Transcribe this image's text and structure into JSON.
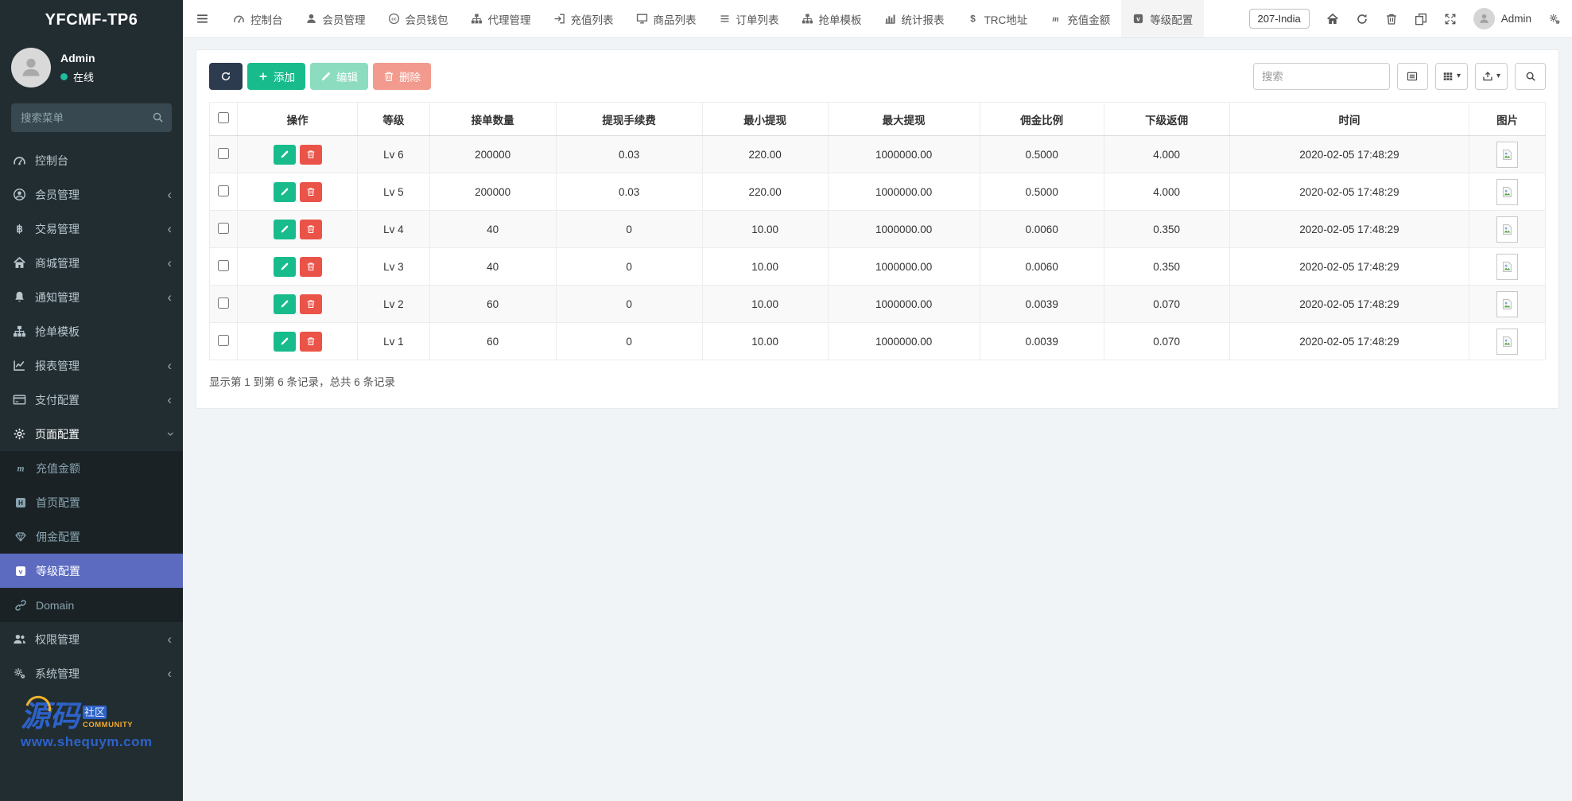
{
  "brand": "YFCMF-TP6",
  "user": {
    "name": "Admin",
    "status": "在线"
  },
  "sidebar": {
    "search_placeholder": "搜索菜单",
    "items": [
      {
        "label": "控制台",
        "icon": "gauge-icon"
      },
      {
        "label": "会员管理",
        "icon": "user-circle-icon",
        "expandable": true
      },
      {
        "label": "交易管理",
        "icon": "bitcoin-icon",
        "expandable": true
      },
      {
        "label": "商城管理",
        "icon": "home-icon",
        "expandable": true
      },
      {
        "label": "通知管理",
        "icon": "bell-icon",
        "expandable": true
      },
      {
        "label": "抢单模板",
        "icon": "sitemap-icon"
      },
      {
        "label": "报表管理",
        "icon": "chart-line-icon",
        "expandable": true
      },
      {
        "label": "支付配置",
        "icon": "credit-card-icon",
        "expandable": true
      },
      {
        "label": "页面配置",
        "icon": "gear-icon",
        "expandable": true,
        "expanded": true,
        "children": [
          {
            "label": "充值金额",
            "icon": "m-icon"
          },
          {
            "label": "首页配置",
            "icon": "h-icon"
          },
          {
            "label": "佣金配置",
            "icon": "gem-icon"
          },
          {
            "label": "等级配置",
            "icon": "v-badge-icon",
            "active": true
          },
          {
            "label": "Domain",
            "icon": "link-icon"
          }
        ]
      },
      {
        "label": "权限管理",
        "icon": "users-icon",
        "expandable": true
      },
      {
        "label": "系统管理",
        "icon": "cogs-icon",
        "expandable": true
      }
    ],
    "watermark": {
      "primary": "源码",
      "secondary": "社区",
      "tertiary": "COMMUNITY",
      "url": "www.shequym.com"
    }
  },
  "topnav": {
    "tabs": [
      {
        "label": "控制台",
        "icon": "gauge-icon"
      },
      {
        "label": "会员管理",
        "icon": "user-icon"
      },
      {
        "label": "会员钱包",
        "icon": "wallet-icon"
      },
      {
        "label": "代理管理",
        "icon": "sitemap-icon"
      },
      {
        "label": "充值列表",
        "icon": "sign-in-icon"
      },
      {
        "label": "商品列表",
        "icon": "desktop-icon"
      },
      {
        "label": "订单列表",
        "icon": "list-icon"
      },
      {
        "label": "抢单模板",
        "icon": "sitemap-icon"
      },
      {
        "label": "统计报表",
        "icon": "bar-chart-icon"
      },
      {
        "label": "TRC地址",
        "icon": "dollar-icon"
      },
      {
        "label": "充值金额",
        "icon": "m-icon"
      },
      {
        "label": "等级配置",
        "icon": "v-badge-icon",
        "active": true
      }
    ],
    "region_badge": "207-India",
    "admin_label": "Admin"
  },
  "toolbar": {
    "add_label": "添加",
    "edit_label": "编辑",
    "delete_label": "删除",
    "search_placeholder": "搜索"
  },
  "table": {
    "columns": [
      "操作",
      "等级",
      "接单数量",
      "提现手续费",
      "最小提现",
      "最大提现",
      "佣金比例",
      "下级返佣",
      "时间",
      "图片"
    ],
    "rows": [
      {
        "level": "Lv 6",
        "qty": "200000",
        "fee": "0.03",
        "min_withdraw": "220.00",
        "max_withdraw": "1000000.00",
        "ratio": "0.5000",
        "rebate": "4.000",
        "time": "2020-02-05 17:48:29"
      },
      {
        "level": "Lv 5",
        "qty": "200000",
        "fee": "0.03",
        "min_withdraw": "220.00",
        "max_withdraw": "1000000.00",
        "ratio": "0.5000",
        "rebate": "4.000",
        "time": "2020-02-05 17:48:29"
      },
      {
        "level": "Lv 4",
        "qty": "40",
        "fee": "0",
        "min_withdraw": "10.00",
        "max_withdraw": "1000000.00",
        "ratio": "0.0060",
        "rebate": "0.350",
        "time": "2020-02-05 17:48:29"
      },
      {
        "level": "Lv 3",
        "qty": "40",
        "fee": "0",
        "min_withdraw": "10.00",
        "max_withdraw": "1000000.00",
        "ratio": "0.0060",
        "rebate": "0.350",
        "time": "2020-02-05 17:48:29"
      },
      {
        "level": "Lv 2",
        "qty": "60",
        "fee": "0",
        "min_withdraw": "10.00",
        "max_withdraw": "1000000.00",
        "ratio": "0.0039",
        "rebate": "0.070",
        "time": "2020-02-05 17:48:29"
      },
      {
        "level": "Lv 1",
        "qty": "60",
        "fee": "0",
        "min_withdraw": "10.00",
        "max_withdraw": "1000000.00",
        "ratio": "0.0039",
        "rebate": "0.070",
        "time": "2020-02-05 17:48:29"
      }
    ],
    "summary": "显示第 1 到第 6 条记录，总共 6 条记录"
  },
  "colors": {
    "sidebar_bg": "#222d32",
    "submenu_bg": "#1a2226",
    "selected_blue": "#5c6bc0",
    "accent_green": "#18bc8c",
    "accent_red": "#ea5348",
    "dark_button": "#2c3b4e",
    "online_dot": "#1dbc9c"
  }
}
